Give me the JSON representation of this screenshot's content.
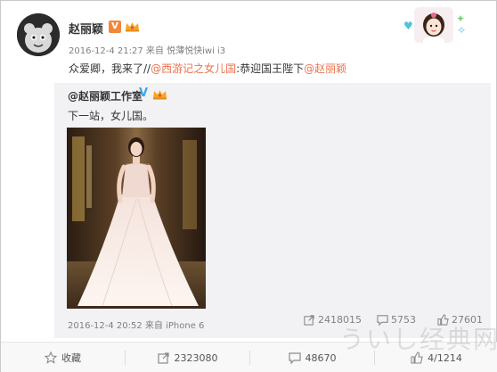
{
  "post": {
    "author": "赵丽颖",
    "meta": "2016-12-4 21:27 来自 悦薄悦快iwi i3",
    "text_prefix": "众爱卿，我来了//",
    "mention_1": "@西游记之女儿国",
    "text_middle": ":恭迎国王陛下",
    "mention_2": "@赵丽颖"
  },
  "repost": {
    "author": "@赵丽颖工作室",
    "text": "下一站，女儿国。",
    "meta": "2016-12-4 20:52 来自 iPhone 6",
    "shares": "2418015",
    "comments": "5753",
    "likes": "27601"
  },
  "actions": {
    "favorite_label": "收藏",
    "share_count": "2323080",
    "comment_count": "48670",
    "like_count": "4/1214"
  },
  "watermark": "ういし经典网",
  "colors": {
    "link": "#eb7350",
    "verified_orange": "#f2873c",
    "verified_blue": "#3aa5f0",
    "card_bg": "#f2f2f5"
  },
  "icons": [
    "verified-badge-icon",
    "crown-icon",
    "share-icon",
    "comment-icon",
    "like-icon",
    "star-icon"
  ]
}
